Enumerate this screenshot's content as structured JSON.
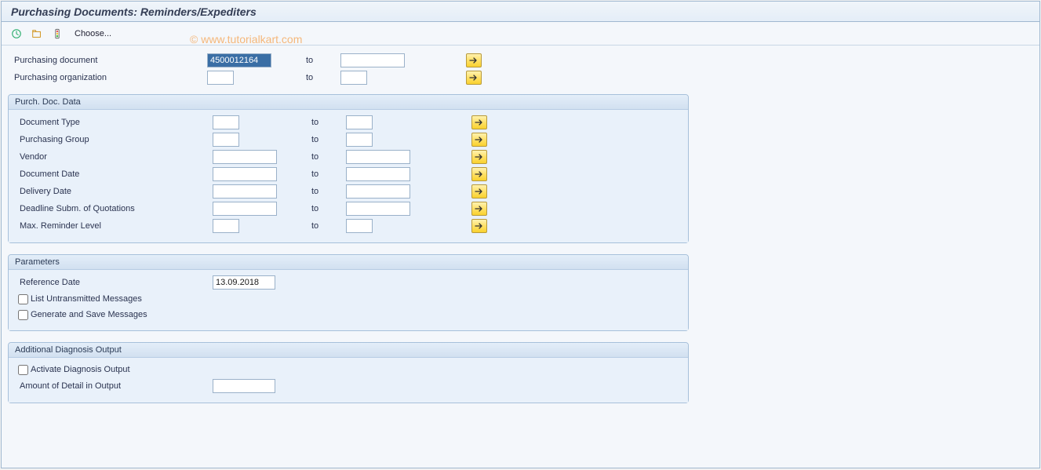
{
  "header": {
    "title": "Purchasing Documents: Reminders/Expediters"
  },
  "toolbar": {
    "choose_label": "Choose..."
  },
  "top": {
    "purch_doc_label": "Purchasing document",
    "purch_doc_value": "4500012164",
    "purch_org_label": "Purchasing organization",
    "to_label": "to"
  },
  "groups": {
    "purch_doc_data": {
      "title": "Purch. Doc. Data",
      "rows": {
        "doc_type": "Document Type",
        "purch_group": "Purchasing Group",
        "vendor": "Vendor",
        "doc_date": "Document Date",
        "delivery_date": "Delivery Date",
        "deadline": "Deadline Subm. of Quotations",
        "max_reminder": "Max. Reminder Level"
      }
    },
    "parameters": {
      "title": "Parameters",
      "reference_date_label": "Reference Date",
      "reference_date_value": "13.09.2018",
      "list_untransmitted": "List Untransmitted Messages",
      "generate_save": "Generate and Save Messages"
    },
    "diagnosis": {
      "title": "Additional Diagnosis Output",
      "activate": "Activate Diagnosis Output",
      "amount_detail": "Amount of Detail in Output"
    }
  },
  "watermark": "© www.tutorialkart.com"
}
